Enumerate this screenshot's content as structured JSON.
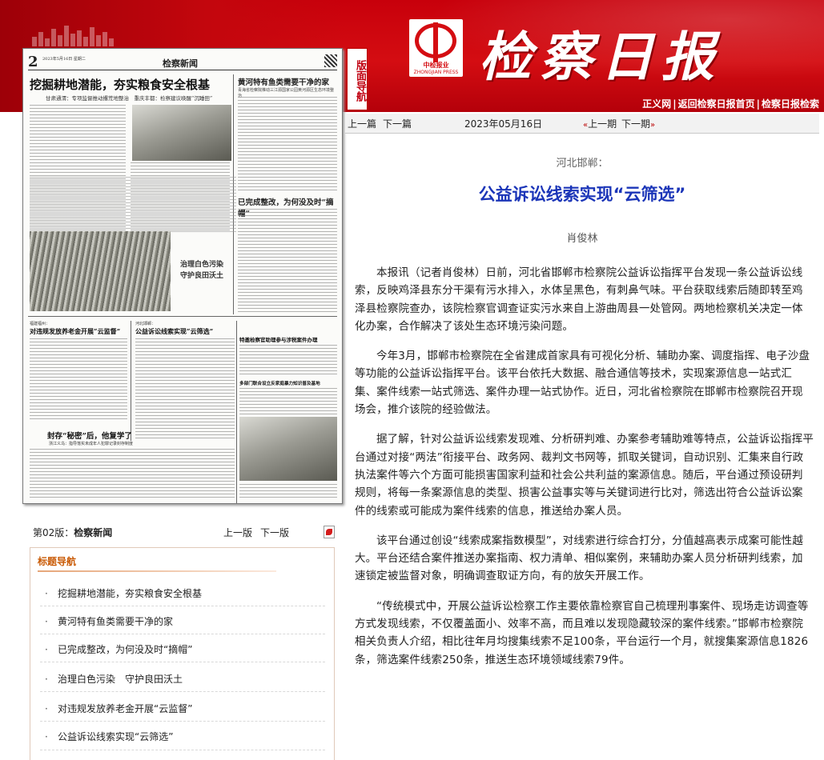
{
  "header": {
    "masthead": "检察日报",
    "guide_tab": "版面导航",
    "logo_cn": "中检报业",
    "logo_en": "ZHONGJIAN PRESS",
    "links": [
      "正义网",
      "返回检察日报首页",
      "检察日报检索"
    ]
  },
  "newspaper": {
    "page_number": "2",
    "date": "2023年5月16日 星期二",
    "section": "检察新闻",
    "main_headline": "挖掘耕地潜能，夯实粮食安全根基",
    "main_sub": "甘肃通渭：专项监督推动撂荒地整治　重庆丰都：检察建议唤醒“沉睡田”",
    "headline_2": "黄河特有鱼类需要干净的家",
    "headline_2_sub": "青海省检察院推动三江源国家公园黄河源区生态环境整治",
    "headline_3": "已完成整改，为何没及时“摘帽”",
    "caption_pollution": "治理白色污染",
    "caption_pollution_2": "守护良田沃土",
    "headline_4": "对违规发放养老金开展“云监督”",
    "headline_4_kicker": "福建福州：",
    "headline_5": "公益诉讼线索实现“云筛选”",
    "headline_5_kicker": "河北邯郸：",
    "headline_6": "特邀检察官助理参与涉税案件办理",
    "headline_7": "多部门联合设立反家庭暴力知识普及基地",
    "headline_8": "封存“秘密”后，他复学了",
    "headline_8_sub": "浙江义乌：指导落实未成年人犯罪记录封存制度"
  },
  "page_nav": {
    "page_label_prefix": "第02版：",
    "page_label_name": "检察新闻",
    "prev": "上一版",
    "next": "下一版"
  },
  "title_nav": {
    "header": "标题导航",
    "items": [
      "挖掘耕地潜能，夯实粮食安全根基",
      "黄河特有鱼类需要干净的家",
      "已完成整改，为何没及时“摘帽”",
      "治理白色污染　守护良田沃土",
      "对违规发放养老金开展“云监督”",
      "公益诉讼线索实现“云筛选”"
    ]
  },
  "article_bar": {
    "prev": "上一篇",
    "next": "下一篇",
    "date": "2023年05月16日",
    "prev_issue": "上一期",
    "next_issue": "下一期"
  },
  "article": {
    "kicker": "河北邯郸：",
    "headline": "公益诉讼线索实现“云筛选”",
    "author": "肖俊林",
    "paragraphs": [
      "本报讯（记者肖俊林）日前，河北省邯郸市检察院公益诉讼指挥平台发现一条公益诉讼线索，反映鸡泽县东分干渠有污水排入，水体呈黑色，有刺鼻气味。平台获取线索后随即转至鸡泽县检察院查办，该院检察官调查证实污水来自上游曲周县一处管网。两地检察机关决定一体化办案，合作解决了该处生态环境污染问题。",
      "今年3月，邯郸市检察院在全省建成首家具有可视化分析、辅助办案、调度指挥、电子沙盘等功能的公益诉讼指挥平台。该平台依托大数据、融合通信等技术，实现案源信息一站式汇集、案件线索一站式筛选、案件办理一站式协作。近日，河北省检察院在邯郸市检察院召开现场会，推介该院的经验做法。",
      "据了解，针对公益诉讼线索发现难、分析研判难、办案参考辅助难等特点，公益诉讼指挥平台通过对接“两法”衔接平台、政务网、裁判文书网等，抓取关键词，自动识别、汇集来自行政执法案件等六个方面可能损害国家利益和社会公共利益的案源信息。随后，平台通过预设研判规则，将每一条案源信息的类型、损害公益事实等与关键词进行比对，筛选出符合公益诉讼案件的线索或可能成为案件线索的信息，推送给办案人员。",
      "该平台通过创设“线索成案指数模型”，对线索进行综合打分，分值越高表示成案可能性越大。平台还结合案件推送办案指南、权力清单、相似案例，来辅助办案人员分析研判线索，加速锁定被监督对象，明确调查取证方向，有的放矢开展工作。",
      "“传统模式中，开展公益诉讼检察工作主要依靠检察官自己梳理刑事案件、现场走访调查等方式发现线索，不仅覆盖面小、效率不高，而且难以发现隐藏较深的案件线索。”邯郸市检察院相关负责人介绍，相比往年月均搜集线索不足100条，平台运行一个月，就搜集案源信息1826条，筛选案件线索250条，推送生态环境领域线索79件。"
    ]
  }
}
